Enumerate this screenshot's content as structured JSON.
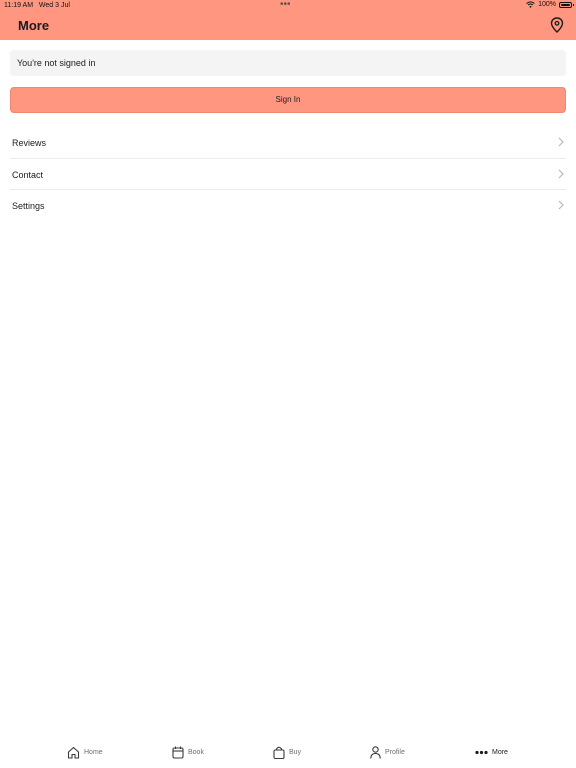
{
  "status_bar": {
    "time": "11:19 AM",
    "date": "Wed 3 Jul",
    "battery": "100%"
  },
  "header": {
    "title": "More",
    "location_icon": "location-pin-icon",
    "background_color": "#ff9680"
  },
  "account": {
    "status_text": "You're not signed in",
    "sign_in_label": "Sign In"
  },
  "menu": {
    "items": [
      {
        "label": "Reviews"
      },
      {
        "label": "Contact"
      },
      {
        "label": "Settings"
      }
    ]
  },
  "tab_bar": {
    "tabs": [
      {
        "label": "Home",
        "icon": "home-icon"
      },
      {
        "label": "Book",
        "icon": "calendar-icon"
      },
      {
        "label": "Buy",
        "icon": "shopping-bag-icon"
      },
      {
        "label": "Profile",
        "icon": "person-icon"
      },
      {
        "label": "More",
        "icon": "more-dots-icon",
        "active": true
      }
    ]
  }
}
